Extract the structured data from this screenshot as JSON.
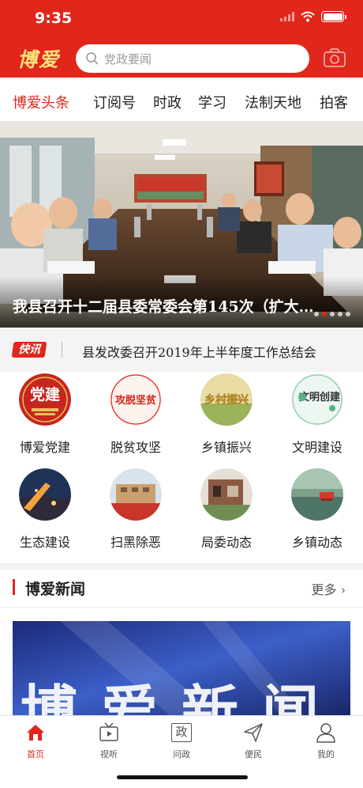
{
  "status_bar": {
    "time": "9:35"
  },
  "header": {
    "logo": "博爱",
    "search_placeholder": "党政要闻",
    "bg_color": "#e1261c"
  },
  "tabs": [
    {
      "label": "博爱头条",
      "active": true
    },
    {
      "label": "订阅号"
    },
    {
      "label": "时政"
    },
    {
      "label": "学习"
    },
    {
      "label": "法制天地"
    },
    {
      "label": "拍客"
    }
  ],
  "hero": {
    "caption": "我县召开十二届县委常委会第145次（扩大…"
  },
  "flash": {
    "tag": "快讯",
    "text": "县发改委召开2019年上半年度工作总结会"
  },
  "grid": [
    {
      "label": "博爱党建",
      "icon_text": "党建",
      "icon": "party-building-icon"
    },
    {
      "label": "脱贫攻坚",
      "icon_text": "攻脱坚贫",
      "icon": "poverty-alleviation-icon"
    },
    {
      "label": "乡镇振兴",
      "icon_text": "乡村振兴",
      "icon": "rural-revitalization-icon"
    },
    {
      "label": "文明建设",
      "icon_text": "文明创建",
      "icon": "civilization-icon"
    },
    {
      "label": "生态建设",
      "icon": "ecology-icon"
    },
    {
      "label": "扫黑除恶",
      "icon": "anti-crime-icon"
    },
    {
      "label": "局委动态",
      "icon": "bureau-news-icon"
    },
    {
      "label": "乡镇动态",
      "icon": "township-news-icon"
    }
  ],
  "news_section": {
    "title": "博爱新闻",
    "more": "更多",
    "banner_text": "博爱新闻"
  },
  "tabbar": [
    {
      "label": "首页",
      "icon": "home-icon",
      "active": true
    },
    {
      "label": "视听",
      "icon": "tv-icon"
    },
    {
      "label": "问政",
      "icon": "zheng-icon",
      "icon_text": "政"
    },
    {
      "label": "便民",
      "icon": "send-icon"
    },
    {
      "label": "我的",
      "icon": "person-icon"
    }
  ]
}
